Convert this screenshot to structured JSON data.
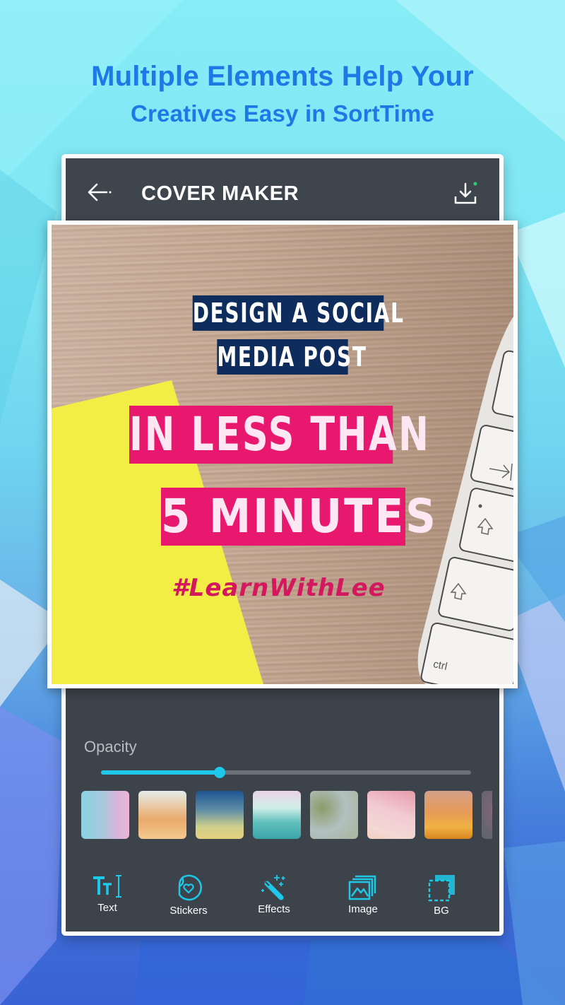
{
  "promo": {
    "headline_line1": "Multiple Elements Help Your",
    "headline_line2": "Creatives Easy in SortTime"
  },
  "app_bar": {
    "back_icon": "arrow-left-icon",
    "title": "COVER MAKER",
    "download_icon": "download-icon",
    "download_badge_color": "#2ecc71"
  },
  "canvas": {
    "texts": [
      {
        "text": "DESIGN A SOCIAL",
        "style": "navy-box"
      },
      {
        "text": "MEDIA POST",
        "style": "navy-box"
      },
      {
        "text": "IN LESS THAN",
        "style": "pink-box"
      },
      {
        "text": "5 MINUTES",
        "style": "pink-box"
      },
      {
        "text": "#LearnWithLee",
        "style": "pink-script"
      }
    ],
    "keyboard_key_label": "ctrl",
    "colors": {
      "navy": "#0e2d5c",
      "pink": "#e7186e",
      "sticky_note": "#f3ee45"
    }
  },
  "opacity": {
    "label": "Opacity",
    "value_percent": 32
  },
  "backgrounds": [
    {
      "name": "cyan-pink-gradient"
    },
    {
      "name": "peach-gradient"
    },
    {
      "name": "blue-yellow-gradient"
    },
    {
      "name": "pink-teal-gradient"
    },
    {
      "name": "olive-grey-gradient"
    },
    {
      "name": "pink-rose-gradient"
    },
    {
      "name": "orange-amber-gradient"
    },
    {
      "name": "bokeh-partial"
    }
  ],
  "toolbar": {
    "accent_color": "#1ec8e8",
    "items": [
      {
        "label": "Text",
        "icon": "text-icon"
      },
      {
        "label": "Stickers",
        "icon": "sticker-icon"
      },
      {
        "label": "Effects",
        "icon": "magic-wand-icon"
      },
      {
        "label": "Image",
        "icon": "image-icon"
      },
      {
        "label": "BG",
        "icon": "background-icon"
      }
    ]
  }
}
